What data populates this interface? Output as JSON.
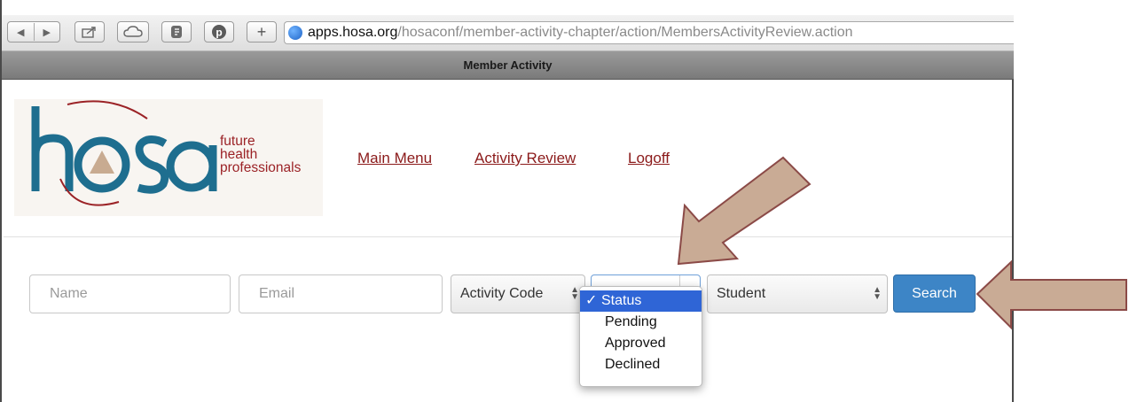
{
  "browser": {
    "url_host": "apps.hosa.org",
    "url_path": "/hosaconf/member-activity-chapter/action/MembersActivityReview.action",
    "window_title": "Member Activity",
    "toolbar_icons": [
      "back-icon",
      "forward-icon",
      "share-icon",
      "icloud-icon",
      "evernote-icon",
      "pinterest-icon",
      "new-tab-icon"
    ]
  },
  "logo": {
    "wordmark": "hosa",
    "tagline": [
      "future",
      "health",
      "professionals"
    ],
    "colors": {
      "teal": "#1e6e8f",
      "red": "#9b2226",
      "tan": "#c8ab91"
    }
  },
  "nav": {
    "main_menu": "Main Menu",
    "activity_review": "Activity Review",
    "logoff": "Logoff"
  },
  "search": {
    "name_placeholder": "Name",
    "email_placeholder": "Email",
    "activity_code": "Activity Code",
    "status_options": [
      "Status",
      "Pending",
      "Approved",
      "Declined"
    ],
    "status_selected": "Status",
    "type": "Student",
    "button": "Search"
  },
  "annotation_color": "#c9ab95"
}
